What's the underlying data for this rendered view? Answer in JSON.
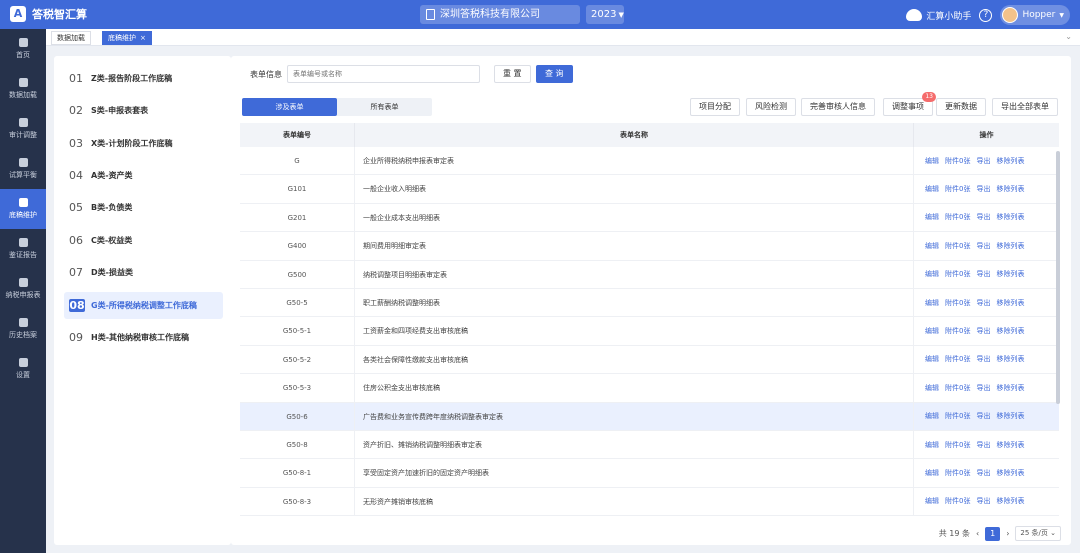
{
  "app": {
    "title": "答税智汇算",
    "logo_glyph": "A",
    "company": "深圳答税科技有限公司",
    "year": "2023",
    "helper": "汇算小助手",
    "help_glyph": "?",
    "user": "Hopper",
    "accent": "#3f6ad8"
  },
  "sidebar": {
    "items": [
      {
        "label": "首页",
        "icon": "home-icon"
      },
      {
        "label": "数据加载",
        "icon": "database-icon"
      },
      {
        "label": "审计调整",
        "icon": "adjust-icon"
      },
      {
        "label": "试算平衡",
        "icon": "balance-icon"
      },
      {
        "label": "底稿维护",
        "icon": "file-icon"
      },
      {
        "label": "鉴证报告",
        "icon": "report-icon"
      },
      {
        "label": "纳税申报表",
        "icon": "monitor-icon"
      },
      {
        "label": "历史档案",
        "icon": "folder-icon"
      },
      {
        "label": "设置",
        "icon": "gear-icon"
      }
    ]
  },
  "tabs": [
    {
      "label": "数据加载"
    },
    {
      "label": "底稿维护",
      "close": "×"
    }
  ],
  "tab_menu_glyph": "⌄",
  "categories": [
    {
      "num": "01",
      "label": "Z类-报告阶段工作底稿"
    },
    {
      "num": "02",
      "label": "S类-申报表套表"
    },
    {
      "num": "03",
      "label": "X类-计划阶段工作底稿"
    },
    {
      "num": "04",
      "label": "A类-资产类"
    },
    {
      "num": "05",
      "label": "B类-负债类"
    },
    {
      "num": "06",
      "label": "C类-权益类"
    },
    {
      "num": "07",
      "label": "D类-损益类"
    },
    {
      "num": "08",
      "label": "G类-所得税纳税调整工作底稿"
    },
    {
      "num": "09",
      "label": "H类-其他纳税审核工作底稿"
    }
  ],
  "filter": {
    "label": "表单信息",
    "placeholder": "表单编号或名称",
    "reset": "重 置",
    "search": "查 询"
  },
  "segment": {
    "involved": "涉及表单",
    "all": "所有表单"
  },
  "actions": {
    "project_allocation": "项目分配",
    "risk_check": "风险检测",
    "complete_reviewer": "完善审核人信息",
    "adjustments": "调整事项",
    "adjustments_badge": "13",
    "update_data": "更新数据",
    "export_all": "导出全部表单"
  },
  "table": {
    "headers": {
      "code": "表单编号",
      "name": "表单名称",
      "ops": "操作"
    },
    "ops": {
      "edit": "编辑",
      "attach": "附件0张",
      "export": "导出",
      "remove": "移除列表"
    },
    "rows": [
      {
        "code": "G",
        "name": "企业所得税纳税申报表审定表"
      },
      {
        "code": "G101",
        "name": "一般企业收入明细表"
      },
      {
        "code": "G201",
        "name": "一般企业成本支出明细表"
      },
      {
        "code": "G400",
        "name": "期间费用明细审定表"
      },
      {
        "code": "G500",
        "name": "纳税调整项目明细表审定表"
      },
      {
        "code": "G50-5",
        "name": "职工薪酬纳税调整明细表"
      },
      {
        "code": "G50-5-1",
        "name": "工资薪金和四项经费支出审核底稿"
      },
      {
        "code": "G50-5-2",
        "name": "各类社会保障性缴款支出审核底稿"
      },
      {
        "code": "G50-5-3",
        "name": "住房公积金支出审核底稿"
      },
      {
        "code": "G50-6",
        "name": "广告费和业务宣传费跨年度纳税调整表审定表"
      },
      {
        "code": "G50-8",
        "name": "资产折旧、摊销纳税调整明细表审定表"
      },
      {
        "code": "G50-8-1",
        "name": "享受固定资产加速折旧的固定资产明细表"
      },
      {
        "code": "G50-8-3",
        "name": "无形资产摊销审核底稿"
      }
    ]
  },
  "pager": {
    "total": "共 19 条",
    "prev": "‹",
    "page": "1",
    "next": "›",
    "size": "25 条/页",
    "size_caret": "⌄"
  }
}
